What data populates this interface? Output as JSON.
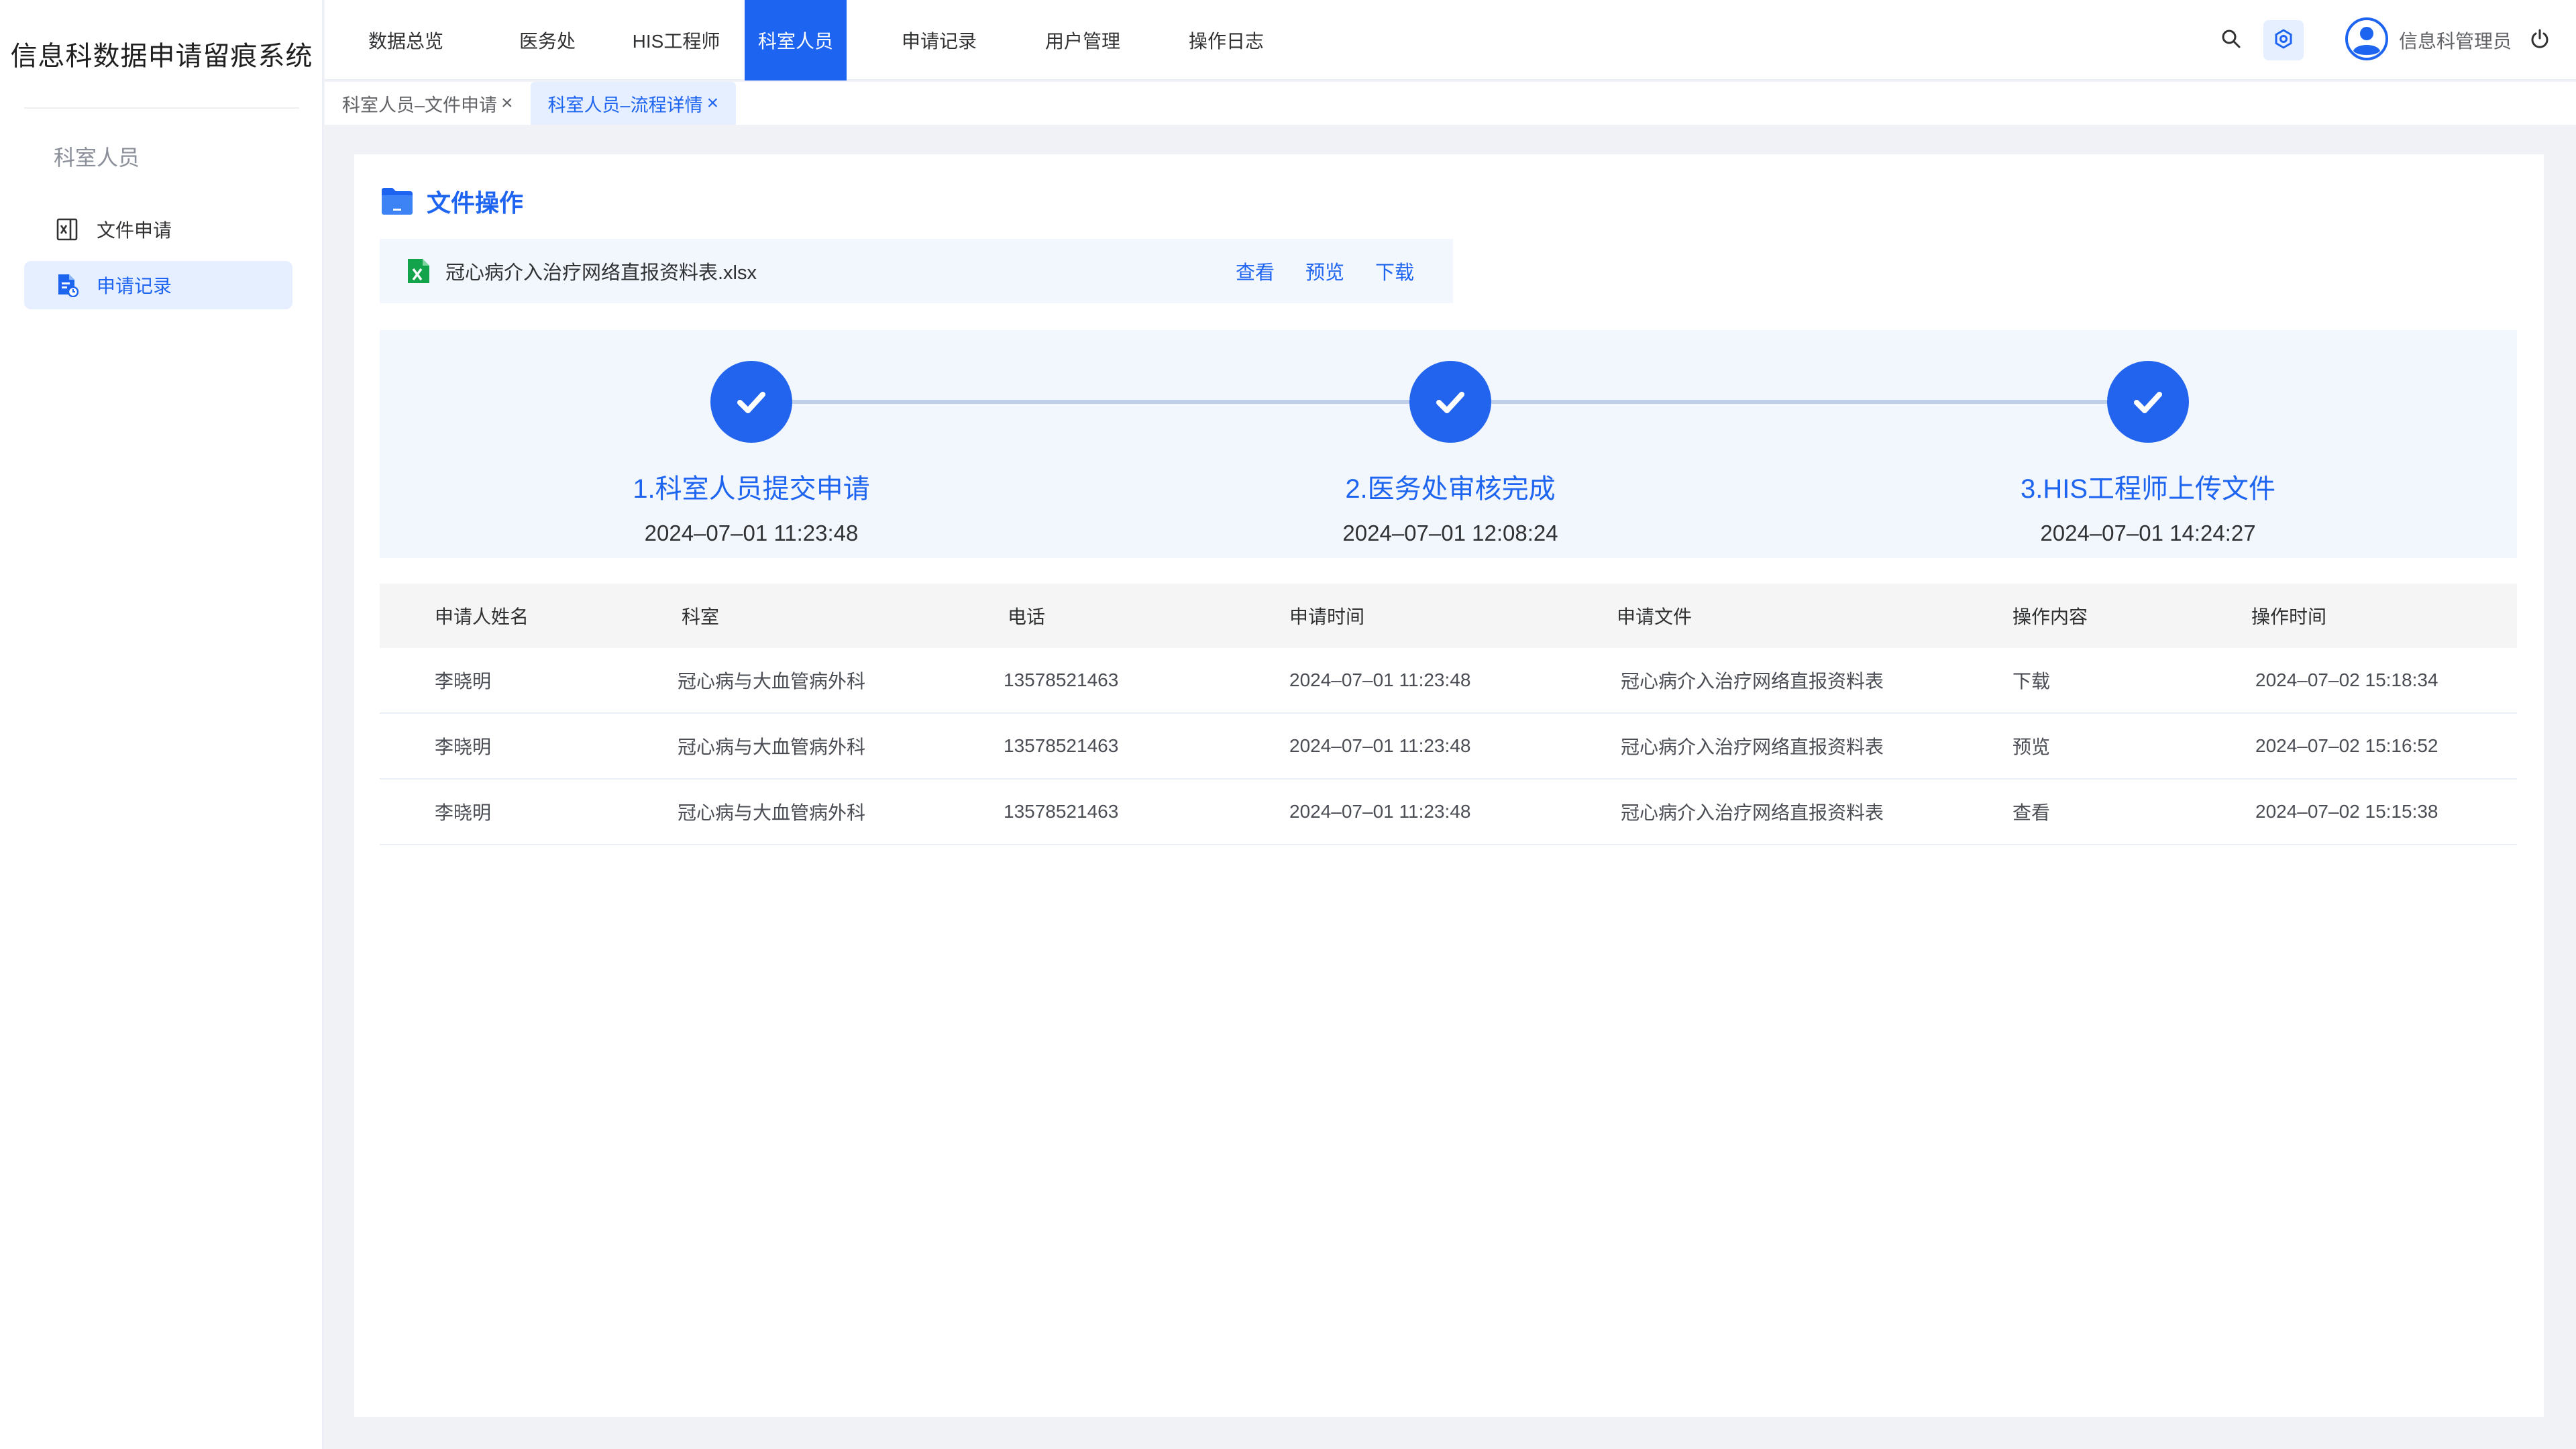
{
  "app": {
    "title": "信息科数据申请留痕系统"
  },
  "sidebar": {
    "section": "科室人员",
    "items": [
      {
        "label": "文件申请",
        "icon": "excel-file-icon",
        "active": false
      },
      {
        "label": "申请记录",
        "icon": "document-record-icon",
        "active": true
      }
    ]
  },
  "header": {
    "nav": [
      "数据总览",
      "医务处",
      "HIS工程师",
      "科室人员",
      "申请记录",
      "用户管理",
      "操作日志"
    ],
    "active_nav": "科室人员",
    "user_name": "信息科管理员"
  },
  "tabs": [
    {
      "label": "科室人员–文件申请",
      "close": "×",
      "active": false
    },
    {
      "label": "科室人员–流程详情",
      "close": "×",
      "active": true
    }
  ],
  "file_section": {
    "title": "文件操作",
    "file_name": "冠心病介入治疗网络直报资料表.xlsx",
    "actions": [
      "查看",
      "预览",
      "下载"
    ]
  },
  "steps": [
    {
      "label": "1.科室人员提交申请",
      "time": "2024–07–01 11:23:48"
    },
    {
      "label": "2.医务处审核完成",
      "time": "2024–07–01 12:08:24"
    },
    {
      "label": "3.HIS工程师上传文件",
      "time": "2024–07–01 14:24:27"
    }
  ],
  "table": {
    "columns": [
      "申请人姓名",
      "科室",
      "电话",
      "申请时间",
      "申请文件",
      "操作内容",
      "操作时间"
    ],
    "rows": [
      [
        "李晓明",
        "冠心病与大血管病外科",
        "13578521463",
        "2024–07–01 11:23:48",
        "冠心病介入治疗网络直报资料表",
        "下载",
        "2024–07–02 15:18:34"
      ],
      [
        "李晓明",
        "冠心病与大血管病外科",
        "13578521463",
        "2024–07–01 11:23:48",
        "冠心病介入治疗网络直报资料表",
        "预览",
        "2024–07–02 15:16:52"
      ],
      [
        "李晓明",
        "冠心病与大血管病外科",
        "13578521463",
        "2024–07–01 11:23:48",
        "冠心病介入治疗网络直报资料表",
        "查看",
        "2024–07–02 15:15:38"
      ]
    ]
  },
  "colors": {
    "primary": "#1d64f0",
    "step_fill": "#2264ee",
    "light_bg": "#f2f6fd",
    "active_bg": "#e6efff"
  }
}
